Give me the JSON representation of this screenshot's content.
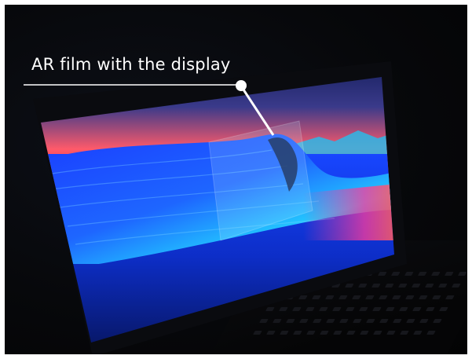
{
  "annotation": {
    "label": "AR film with the display"
  },
  "colors": {
    "background": "#050608",
    "sky_top": "#1e2a6a",
    "sky_glow": "#ff3a5a",
    "wave": "#1560ff",
    "wave_highlight": "#37d6ff",
    "callout": "#ffffff"
  },
  "icons": [
    "callout-dot-icon"
  ]
}
